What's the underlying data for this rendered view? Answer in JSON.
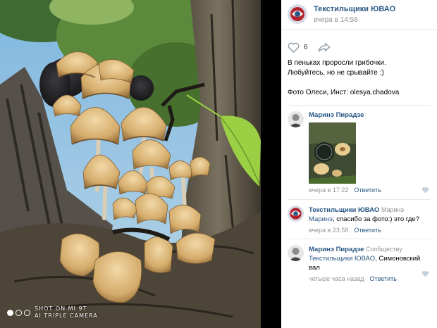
{
  "photo": {
    "watermark_line1": "SHOT ON MI 9T",
    "watermark_line2": "AI TRIPLE CAMERA"
  },
  "post": {
    "author": "Текстильщики ЮВАО",
    "date": "вчера в 14:58",
    "likes": "6",
    "text_line1": "В пеньках проросли грибочки.",
    "text_line2": "Любуйтесь, но не срывайте :)",
    "text_credit": "Фото Олеси, Инст: olesya.chadova"
  },
  "comments": [
    {
      "author": "Маринэ Пирадзе",
      "date": "вчера в 17:22",
      "reply": "Ответить"
    },
    {
      "author": "Текстильщики ЮВАО",
      "reply_to": "Маринэ",
      "text_mention": "Маринэ",
      "text_rest": ", спасибо за фото:) это где?",
      "date": "вчера в 23:58",
      "reply": "Ответить"
    },
    {
      "author": "Маринэ Пирадзе",
      "reply_to": "Сообществу",
      "text_mention": "Текстильщики ЮВАО",
      "text_rest": ", Симоновский вал",
      "date": "четыре часа назад",
      "reply": "Ответить"
    }
  ],
  "colors": {
    "link": "#2a5885",
    "meta": "#939393",
    "heart": "#c5d0db"
  }
}
